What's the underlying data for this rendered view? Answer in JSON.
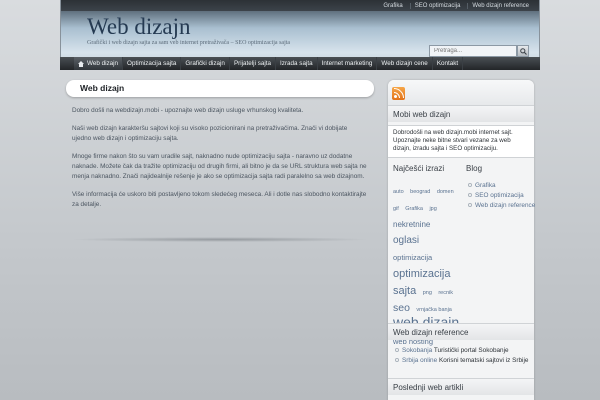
{
  "header": {
    "top_links": [
      "Grafika",
      "SEO optimizacija",
      "Web dizajn reference"
    ],
    "site_title": "Web dizajn",
    "tagline": "Grafički i web dizajn sajta za sam veb internet pretraživača – SEO optimizacija sajta",
    "search_placeholder": "Pretraga..."
  },
  "nav": {
    "items": [
      "Web dizajn",
      "Optimizacija sajta",
      "Grafički dizajn",
      "Prijatelji sajta",
      "Izrada sajta",
      "Internet marketing",
      "Web dizajn cene",
      "Kontakt"
    ]
  },
  "post": {
    "title": "Web dizajn",
    "paragraphs": [
      "Dobro došli na webdizajn.mobi - upoznajte web dizajn usluge vrhunskog kvaliteta.",
      "Naši web dizajn karakteršu sajtovi koji su visoko pozicionirani na pretraživačima. Znači vi dobijate ujedno web dizajn i optimizaciju sajta.",
      "Mnoge firme nakon što su vam uradile sajt, naknadno nude optimizaciju sajta - naravno uz dodatne naknade. Možete čak da tražite optimizaciju od drugih firmi, ali bitno je da se URL struktura web sajta ne menja naknadno. Znači najidealnije rešenje je ako se optimizacija sajta radi paralelno sa web dizajnom.",
      "Više informacija će uskoro biti postavljeno tokom sledećeg meseca. Ali i dotle nas slobodno kontaktirajte za detalje."
    ]
  },
  "sidebar": {
    "mobi": {
      "heading": "Mobi web dizajn",
      "text": "Dobrodošli na web dizajn.mobi internet sajt. Upoznajte neke bitne stvari vezane za web dizajn, izradu sajta i SEO optimizaciju."
    },
    "tags": {
      "heading": "Najčešći izrazi",
      "items": [
        {
          "text": "auto",
          "size": 5.5
        },
        {
          "text": "beograd",
          "size": 5.5
        },
        {
          "text": "domen",
          "size": 5.5
        },
        {
          "text": "gif",
          "size": 5.5
        },
        {
          "text": "Grafika",
          "size": 5.5
        },
        {
          "text": "jpg",
          "size": 5.5
        },
        {
          "text": "nekretnine",
          "size": 8
        },
        {
          "text": "oglasi",
          "size": 10
        },
        {
          "text": "optimizacija",
          "size": 7.5
        },
        {
          "text": "optimizacija sajta",
          "size": 11
        },
        {
          "text": "png",
          "size": 5.5
        },
        {
          "text": "recnik",
          "size": 5.5
        },
        {
          "text": "seo",
          "size": 10.5
        },
        {
          "text": "vrnjačka banja",
          "size": 5.5
        },
        {
          "text": "web dizajn",
          "size": 14
        },
        {
          "text": "web hosting",
          "size": 7.5
        }
      ]
    },
    "blog": {
      "heading": "Blog",
      "items": [
        "Grafika",
        "SEO optimizacija",
        "Web dizajn reference"
      ]
    },
    "references": {
      "heading": "Web dizajn reference",
      "items": [
        {
          "link": "Sokobanja",
          "text": "Turistički portal Sokobanje"
        },
        {
          "link": "Srbija online",
          "text": "Korisni tematski sajtovi iz Srbije"
        }
      ]
    },
    "latest": {
      "heading": "Poslednji web artikli"
    }
  }
}
